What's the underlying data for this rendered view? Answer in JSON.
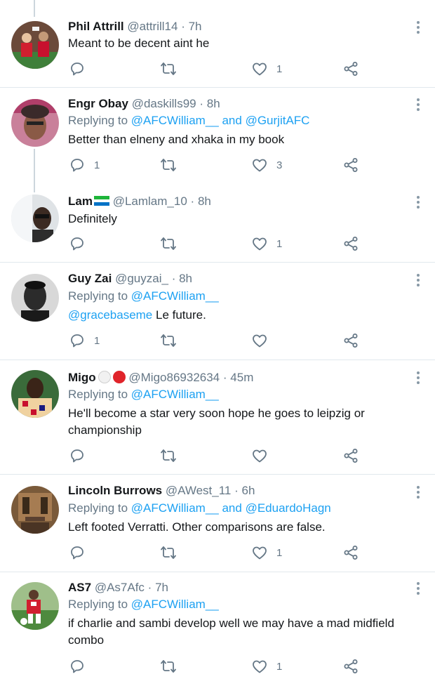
{
  "colors": {
    "link": "#1da1f2",
    "muted": "#657786",
    "divider": "#e1e8ed"
  },
  "icons": {
    "reply": "reply-icon",
    "retweet": "retweet-icon",
    "like": "heart-icon",
    "share": "share-icon",
    "more": "more-icon"
  },
  "replying_to": "Replying to",
  "and_word": "and",
  "tweets": [
    {
      "name": "Phil Attrill",
      "handle": "@attrill14",
      "time": "7h",
      "text": "Meant to be decent aint he",
      "replies": "",
      "retweets": "",
      "likes": "1"
    },
    {
      "name": "Engr Obay",
      "handle": "@daskills99",
      "time": "8h",
      "reply_to_1": "@AFCWilliam__",
      "reply_to_2": "@GurjitAFC",
      "text": "Better than elneny and xhaka in my book",
      "replies": "1",
      "retweets": "",
      "likes": "3"
    },
    {
      "name": "Lam",
      "handle": "@Lamlam_10",
      "time": "8h",
      "text": "Definitely",
      "replies": "",
      "retweets": "",
      "likes": "1"
    },
    {
      "name": "Guy Zai",
      "handle": "@guyzai_",
      "time": "8h",
      "reply_to_1": "@AFCWilliam__",
      "mention": "@gracebaseme",
      "text": "Le future.",
      "replies": "1",
      "retweets": "",
      "likes": ""
    },
    {
      "name": "Migo",
      "handle": "@Migo86932634",
      "time": "45m",
      "reply_to_1": "@AFCWilliam__",
      "text": "He'll become a star very soon  hope  he goes to leipzig or championship",
      "replies": "",
      "retweets": "",
      "likes": ""
    },
    {
      "name": "Lincoln Burrows",
      "handle": "@AWest_11",
      "time": "6h",
      "reply_to_1": "@AFCWilliam__",
      "reply_to_2": "@EduardoHagn",
      "text": "Left footed Verratti. Other comparisons are false.",
      "replies": "",
      "retweets": "",
      "likes": "1"
    },
    {
      "name": "AS7",
      "handle": "@As7Afc",
      "time": "7h",
      "reply_to_1": "@AFCWilliam__",
      "text": "if charlie and sambi develop well we may have a mad midfield combo",
      "replies": "",
      "retweets": "",
      "likes": "1"
    }
  ]
}
